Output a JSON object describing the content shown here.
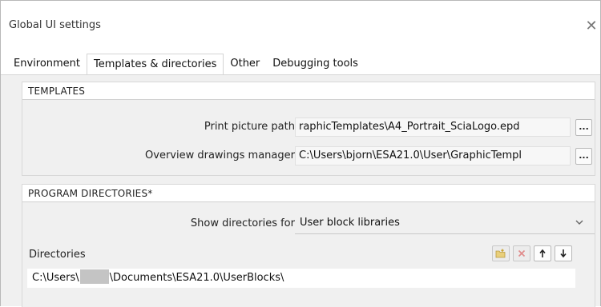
{
  "window": {
    "title": "Global UI settings",
    "close_glyph": "✕"
  },
  "tabs": [
    {
      "label": "Environment",
      "active": false
    },
    {
      "label": "Templates & directories",
      "active": true
    },
    {
      "label": "Other",
      "active": false
    },
    {
      "label": "Debugging tools",
      "active": false
    }
  ],
  "templates": {
    "header": "TEMPLATES",
    "print_picture": {
      "label": "Print picture path",
      "value": "raphicTemplates\\A4_Portrait_SciaLogo.epd",
      "browse_label": "..."
    },
    "overview_drawings": {
      "label": "Overview drawings manager",
      "value": "C:\\Users\\bjorn\\ESA21.0\\User\\GraphicTempl",
      "browse_label": "..."
    }
  },
  "program_directories": {
    "header": "PROGRAM DIRECTORIES*",
    "show_for_label": "Show directories for",
    "show_for_value": "User block libraries",
    "directories_label": "Directories",
    "toolbar": {
      "new_folder_icon": "new-folder-icon",
      "delete_icon": "delete-icon",
      "move_up_icon": "arrow-up-icon",
      "move_down_icon": "arrow-down-icon"
    },
    "entries": [
      {
        "prefix": "C:\\Users\\",
        "suffix": "\\Documents\\ESA21.0\\UserBlocks\\"
      }
    ]
  },
  "colors": {
    "panel_bg": "#f0f0f0",
    "header_bg": "#ffffff",
    "delete_red": "#d23c3c"
  }
}
